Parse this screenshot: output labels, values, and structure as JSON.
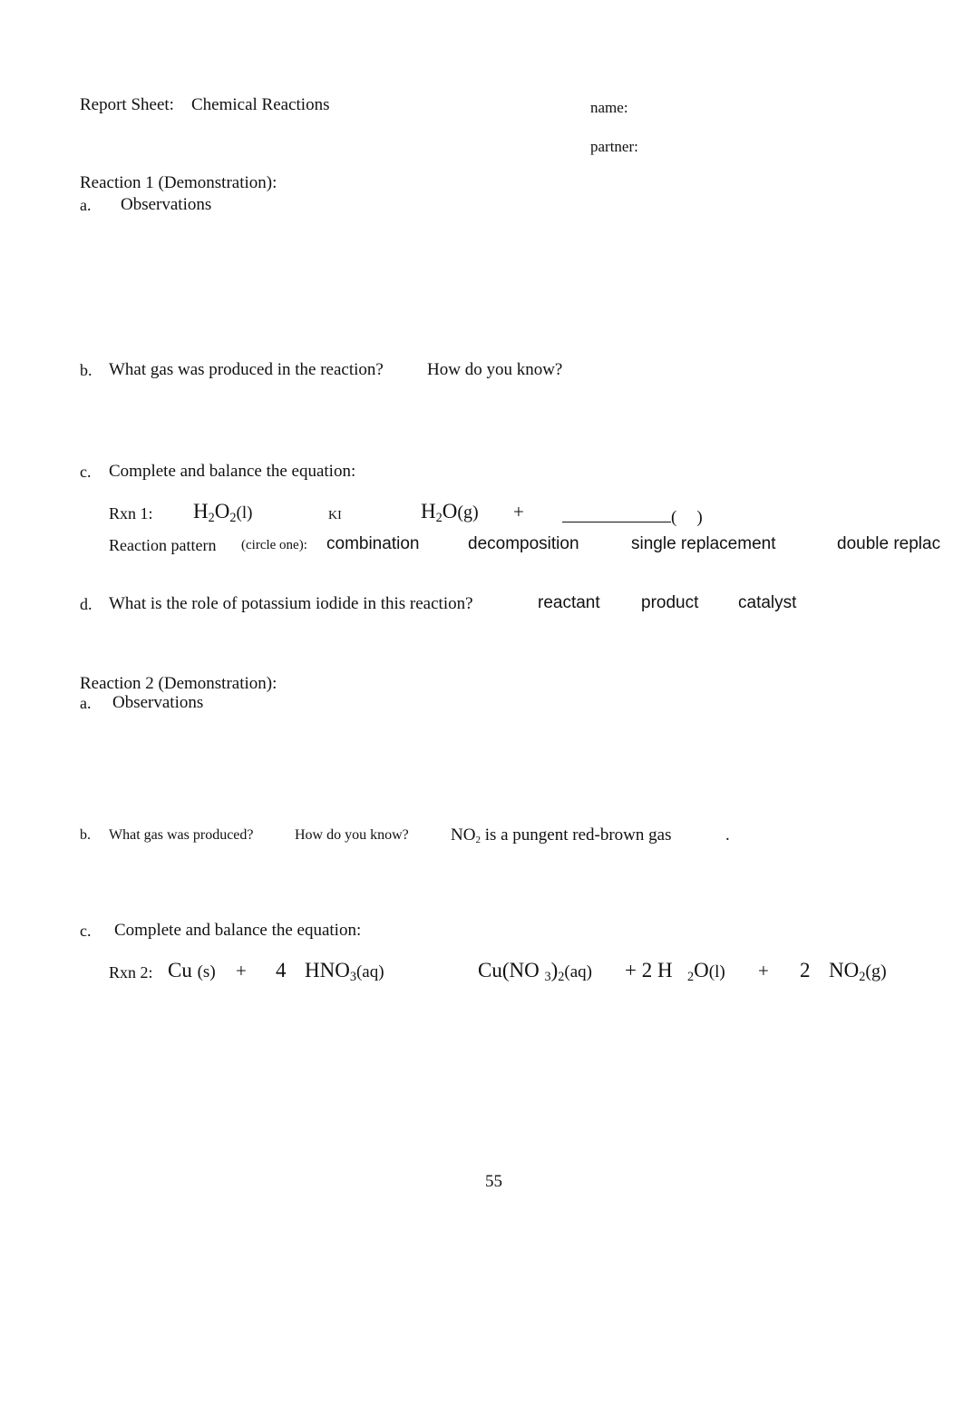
{
  "header": {
    "report_label": "Report Sheet:",
    "title": "Chemical Reactions",
    "name_label": "name:",
    "partner_label": "partner:"
  },
  "reaction1": {
    "heading": "Reaction 1 (Demonstration):",
    "a": {
      "marker": "a.",
      "label": "Observations"
    },
    "b": {
      "marker": "b.",
      "question": "What gas was produced in the reaction?",
      "followup": "How do you know?"
    },
    "c": {
      "marker": "c.",
      "prompt": "Complete and balance the equation:",
      "rxn_label": "Rxn 1:",
      "reactant": {
        "e1": "H",
        "s1": "2",
        "e2": "O",
        "s2": "2",
        "state": "(l)"
      },
      "catalyst_label": "KI",
      "product1": {
        "e1": "H",
        "s1": "2",
        "e2": "O",
        "state": "(g)"
      },
      "plus": "+",
      "blank_open": "(",
      "blank_close": ")",
      "pattern_label": "Reaction pattern",
      "pattern_hint": "(circle one):",
      "pattern_options": [
        "combination",
        "decomposition",
        "single replacement",
        "double replac"
      ]
    },
    "d": {
      "marker": "d.",
      "question": "What is the role of potassium iodide in this reaction?",
      "options": [
        "reactant",
        "product",
        "catalyst"
      ]
    }
  },
  "reaction2": {
    "heading": "Reaction 2 (Demonstration):",
    "a": {
      "marker": "a.",
      "label": "Observations"
    },
    "b": {
      "marker": "b.",
      "question": "What gas was produced?",
      "followup": "How do you know?",
      "answer_formula": {
        "e1": "NO",
        "s1": "2"
      },
      "answer_text": "is a pungent red-brown gas",
      "period": "."
    },
    "c": {
      "marker": "c.",
      "prompt": "Complete and balance the equation:",
      "rxn_label": "Rxn 2:",
      "cu": {
        "e1": "Cu",
        "state": "(s)"
      },
      "plus1": "+",
      "coef_hno3": "4",
      "hno3": {
        "e1": "HNO",
        "s1": "3",
        "state": "(aq)"
      },
      "cuno3": {
        "e1": "Cu(NO",
        "s1": "3",
        "e2": ")",
        "s2": "2",
        "state": "(aq)"
      },
      "plus_coef_h2o": "+ 2 H",
      "h2o": {
        "s1": "2",
        "e2": "O",
        "state": "(l)"
      },
      "plus2": "+",
      "coef_no2": "2",
      "no2": {
        "e1": "NO",
        "s1": "2",
        "state": "(g)"
      }
    }
  },
  "footer": {
    "page_number": "55"
  }
}
